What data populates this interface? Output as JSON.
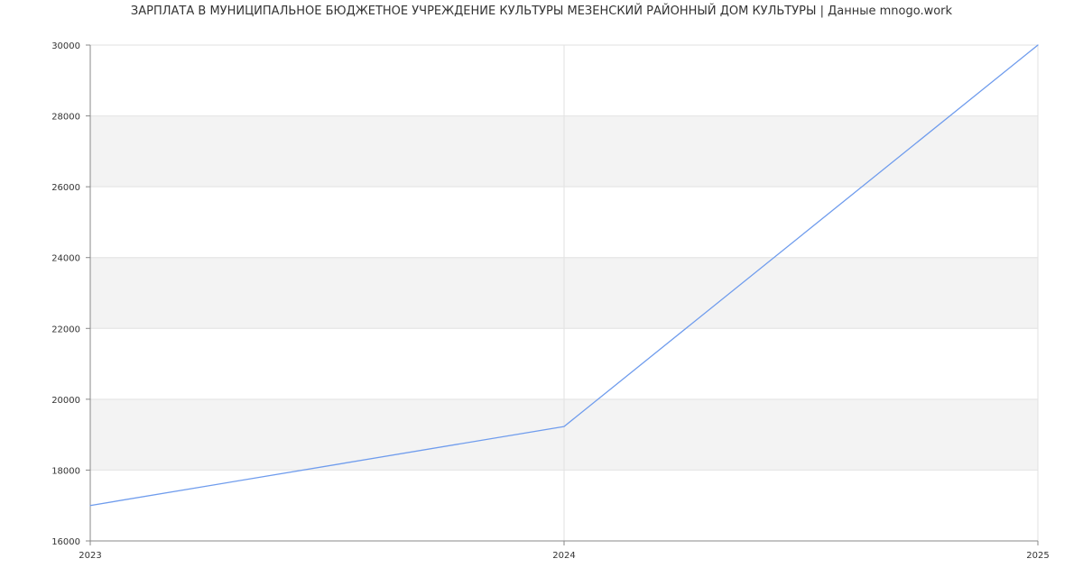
{
  "chart_data": {
    "type": "line",
    "title": "ЗАРПЛАТА В МУНИЦИПАЛЬНОЕ БЮДЖЕТНОЕ УЧРЕЖДЕНИЕ КУЛЬТУРЫ МЕЗЕНСКИЙ РАЙОННЫЙ ДОМ КУЛЬТУРЫ | Данные mnogo.work",
    "xlabel": "",
    "ylabel": "",
    "x": [
      2023,
      2024,
      2025
    ],
    "x_tick_labels": [
      "2023",
      "2024",
      "2025"
    ],
    "xlim": [
      2023,
      2025
    ],
    "ylim": [
      16000,
      30000
    ],
    "y_ticks": [
      16000,
      18000,
      20000,
      22000,
      24000,
      26000,
      28000,
      30000
    ],
    "y_tick_labels": [
      "16000",
      "18000",
      "20000",
      "22000",
      "24000",
      "26000",
      "28000",
      "30000"
    ],
    "series": [
      {
        "values": [
          17000,
          19230,
          30000
        ],
        "color": "#6f9ced"
      }
    ],
    "grid": true,
    "band_color": "#f3f3f3",
    "grid_color": "#e2e2e2",
    "axis_color": "#888888",
    "legend": "none"
  }
}
